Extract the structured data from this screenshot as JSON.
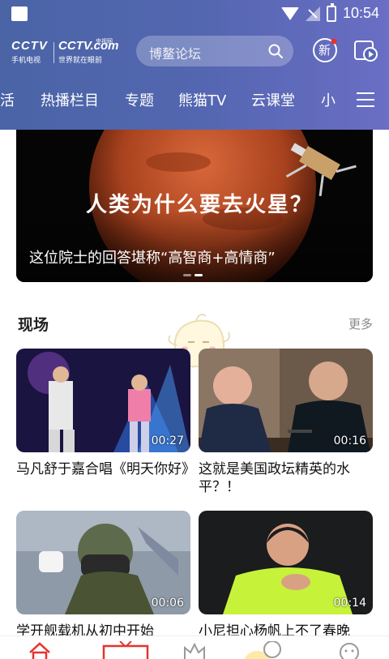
{
  "status_bar": {
    "time": "10:54"
  },
  "header": {
    "logo": {
      "brand": "CCTV",
      "sub_left": "手机电视",
      "brand_com": "CCTV.com",
      "sub_right": "世界就在眼前",
      "tiny": "央视网"
    },
    "search_placeholder": "博鳌论坛",
    "new_badge_label": "新"
  },
  "tabs": [
    "活",
    "热播栏目",
    "专题",
    "熊猫TV",
    "云课堂",
    "小"
  ],
  "banner": {
    "overlay_text": "人类为什么要去火星？",
    "title": "这位院士的回答堪称“高智商+高情商”"
  },
  "section": {
    "title": "现场",
    "more": "更多"
  },
  "videos": [
    {
      "caption": "马凡舒于嘉合唱《明天你好》",
      "duration": "00:27"
    },
    {
      "caption": "这就是美国政坛精英的水平？！",
      "duration": "00:16"
    },
    {
      "caption": "学开舰载机从初中开始",
      "duration": "00:06"
    },
    {
      "caption": "小尼担心杨帆上不了春晚",
      "duration": "00:14"
    }
  ],
  "icons": {
    "search": "search-icon",
    "new": "new-icon",
    "tv_play": "tv-play-icon",
    "menu": "menu-icon"
  },
  "colors": {
    "header_start": "#4a64a6",
    "header_end": "#6a6ec4",
    "accent": "#e6322f"
  }
}
